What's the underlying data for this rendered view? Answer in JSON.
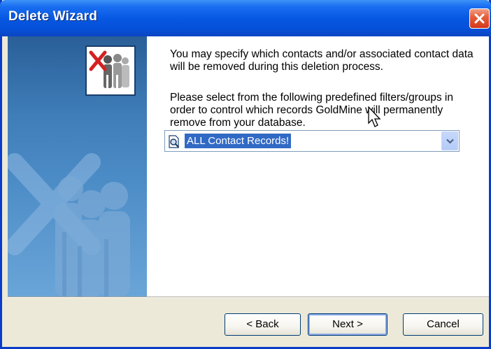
{
  "window": {
    "title": "Delete Wizard",
    "close_icon": "close-icon"
  },
  "content": {
    "paragraph1": "You may specify which contacts and/or associated contact data will be removed during this deletion process.",
    "paragraph2": "Please select from the following predefined filters/groups in order to control which records GoldMine will permanently remove from your database."
  },
  "filter_combo": {
    "selected_value": "ALL Contact Records!",
    "icon": "magnifier-document-icon"
  },
  "buttons": {
    "back": "< Back",
    "next": "Next >",
    "cancel": "Cancel"
  },
  "colors": {
    "titlebar": "#0758e3",
    "selection": "#316ac5",
    "dialog_bg": "#ece9d8"
  }
}
